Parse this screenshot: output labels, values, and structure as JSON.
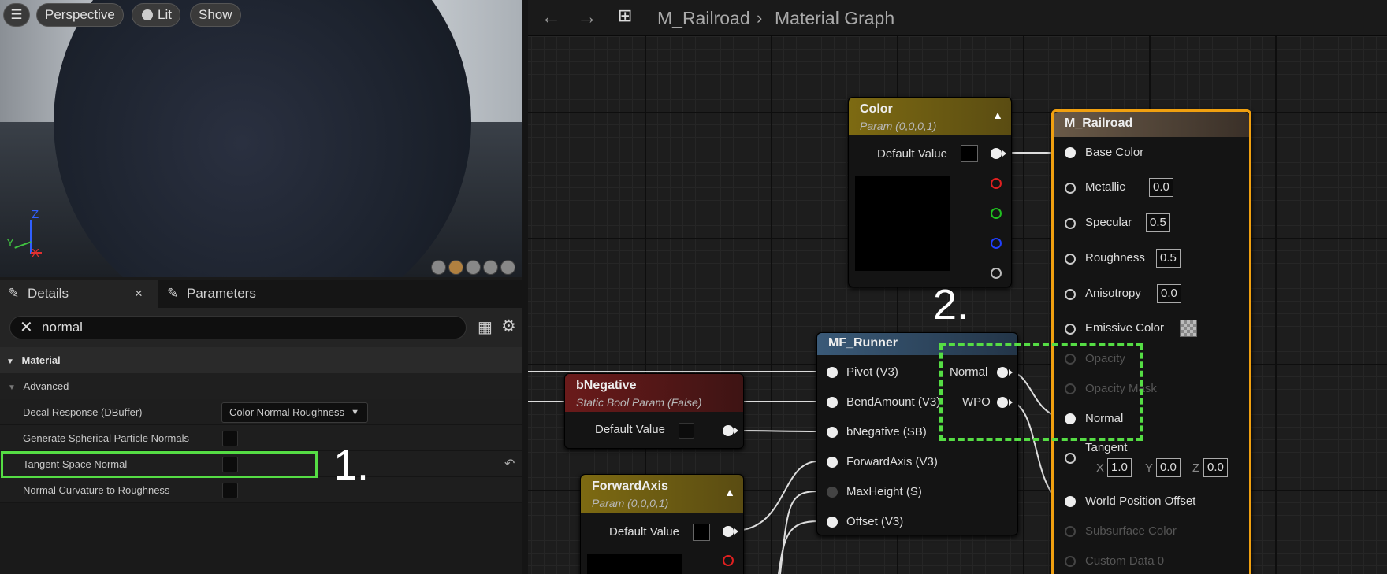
{
  "viewport": {
    "buttons": {
      "perspective": "Perspective",
      "lit": "Lit",
      "show": "Show"
    },
    "gizmo": {
      "z": "Z",
      "y": "Y",
      "x": "X"
    }
  },
  "details_panel": {
    "tabs": [
      {
        "label": "Details"
      },
      {
        "label": "Parameters"
      }
    ],
    "search": {
      "value": "normal"
    },
    "section_material": "Material",
    "section_advanced": "Advanced",
    "rows": [
      {
        "label": "Decal Response (DBuffer)",
        "value": "Color Normal Roughness"
      },
      {
        "label": "Generate Spherical Particle Normals"
      },
      {
        "label": "Tangent Space Normal"
      },
      {
        "label": "Normal Curvature to Roughness"
      }
    ]
  },
  "annotations": {
    "step1": "1.",
    "step2": "2.",
    "highlight_color": "#55dd44"
  },
  "graph": {
    "breadcrumb": {
      "asset": "M_Railroad",
      "view": "Material Graph"
    },
    "color_node": {
      "title": "Color",
      "subtitle": "Param (0,0,0,1)",
      "default_label": "Default Value"
    },
    "bnegative_node": {
      "title": "bNegative",
      "subtitle": "Static Bool Param (False)",
      "default_label": "Default Value"
    },
    "forwardaxis_node": {
      "title": "ForwardAxis",
      "subtitle": "Param (0,0,0,1)",
      "default_label": "Default Value"
    },
    "mf_runner": {
      "title": "MF_Runner",
      "inputs": [
        "Pivot (V3)",
        "BendAmount (V3)",
        "bNegative (SB)",
        "ForwardAxis (V3)",
        "MaxHeight (S)",
        "Offset (V3)"
      ],
      "outputs": [
        "Normal",
        "WPO"
      ]
    },
    "material_node": {
      "title": "M_Railroad",
      "base_color": "Base Color",
      "metallic": {
        "label": "Metallic",
        "value": "0.0"
      },
      "specular": {
        "label": "Specular",
        "value": "0.5"
      },
      "roughness": {
        "label": "Roughness",
        "value": "0.5"
      },
      "anisotropy": {
        "label": "Anisotropy",
        "value": "0.0"
      },
      "emissive": "Emissive Color",
      "opacity": "Opacity",
      "opacity_mask": "Opacity Mask",
      "normal": "Normal",
      "tangent": {
        "label": "Tangent",
        "x_label": "X",
        "x": "1.0",
        "y_label": "Y",
        "y": "0.0",
        "z_label": "Z",
        "z": "0.0"
      },
      "wpo": "World Position Offset",
      "subsurface": "Subsurface Color",
      "custom_data": "Custom Data 0"
    }
  }
}
